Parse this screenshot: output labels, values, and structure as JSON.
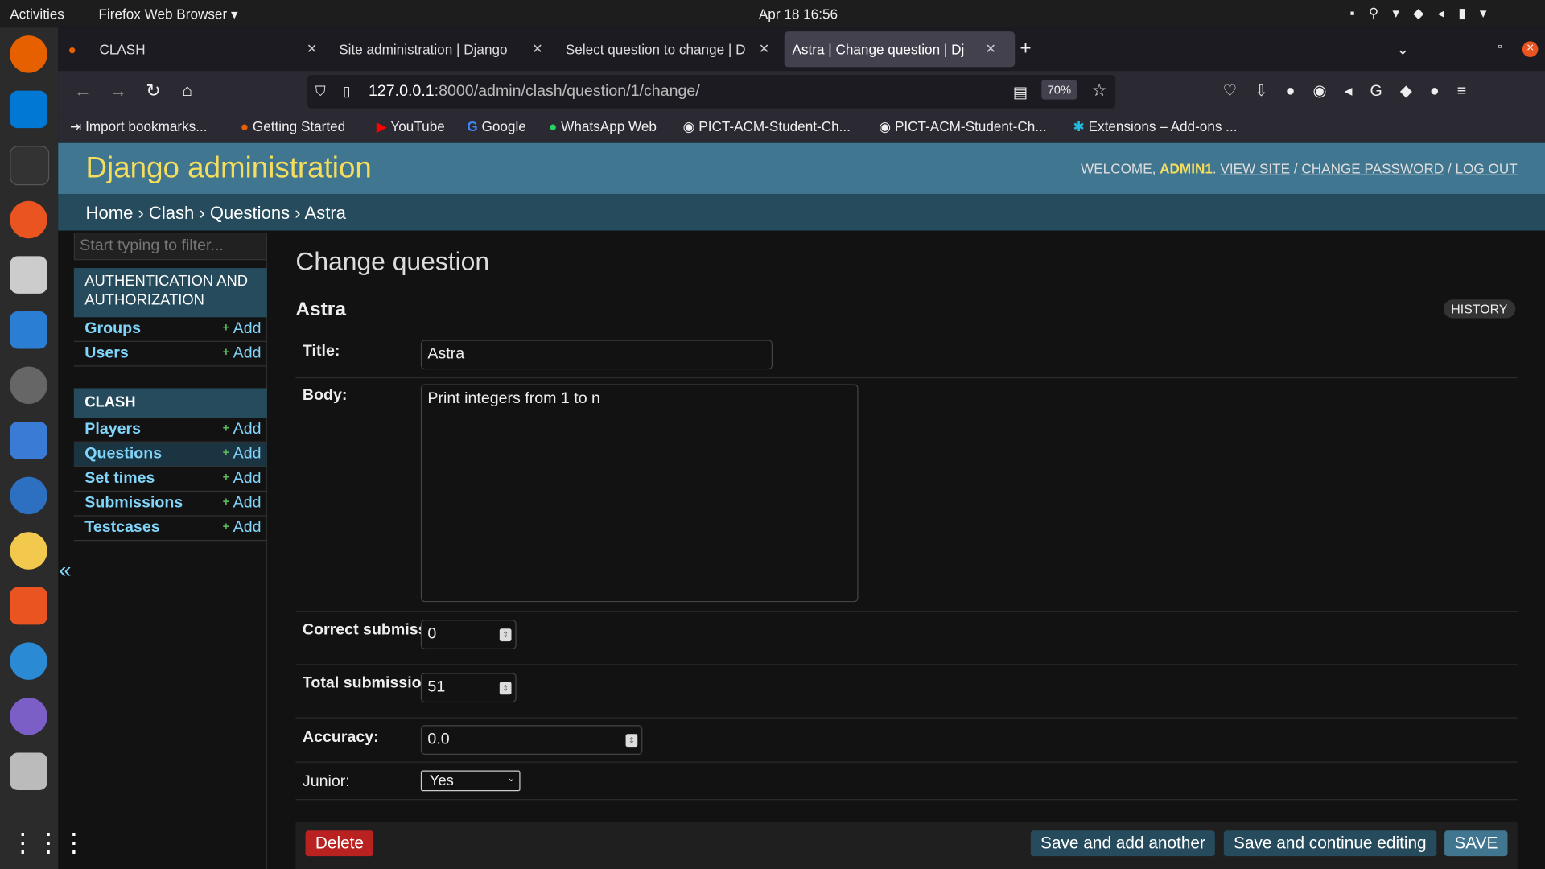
{
  "system": {
    "activities": "Activities",
    "app_menu": "Firefox Web Browser",
    "clock": "Apr 18  16:56"
  },
  "browser": {
    "tabs": [
      {
        "label": "CLASH"
      },
      {
        "label": "Site administration | Django"
      },
      {
        "label": "Select question to change | D"
      },
      {
        "label": "Astra | Change question | Dj",
        "active": true
      }
    ],
    "url_host": "127.0.0.1",
    "url_path": ":8000/admin/clash/question/1/change/",
    "zoom": "70%",
    "bookmarks": [
      "Import bookmarks...",
      "Getting Started",
      "YouTube",
      "Google",
      "WhatsApp Web",
      "PICT-ACM-Student-Ch...",
      "PICT-ACM-Student-Ch...",
      "Extensions – Add-ons ..."
    ]
  },
  "admin": {
    "site_title": "Django administration",
    "user_tools": {
      "welcome": "WELCOME,",
      "user": "ADMIN1",
      "view_site": "VIEW SITE",
      "change_password": "CHANGE PASSWORD",
      "logout": "LOG OUT",
      "sep": "/"
    },
    "breadcrumbs": [
      "Home",
      "Clash",
      "Questions",
      "Astra"
    ],
    "filter_placeholder": "Start typing to filter...",
    "apps": [
      {
        "name": "AUTHENTICATION AND AUTHORIZATION",
        "models": [
          "Groups",
          "Users"
        ]
      },
      {
        "name": "CLASH",
        "models": [
          "Players",
          "Questions",
          "Set times",
          "Submissions",
          "Testcases"
        ]
      }
    ],
    "add_label": "Add",
    "plus": "+",
    "page_title": "Change question",
    "object_name": "Astra",
    "history": "HISTORY",
    "fields": {
      "title": {
        "label": "Title:",
        "value": "Astra"
      },
      "body": {
        "label": "Body:",
        "value": "Print integers from 1 to n"
      },
      "correct": {
        "label": "Correct submissions:",
        "value": "0"
      },
      "total": {
        "label": "Total submissions:",
        "value": "51"
      },
      "accuracy": {
        "label": "Accuracy:",
        "value": "0.0"
      },
      "junior": {
        "label": "Junior:",
        "value": "Yes"
      }
    },
    "buttons": {
      "delete": "Delete",
      "save_add": "Save and add another",
      "save_continue": "Save and continue editing",
      "save": "SAVE"
    },
    "collapse": "«"
  },
  "colors": {
    "header": "#417690",
    "breadcrumb": "#264b5d",
    "link": "#81d4fa",
    "delete": "#ba2121"
  }
}
